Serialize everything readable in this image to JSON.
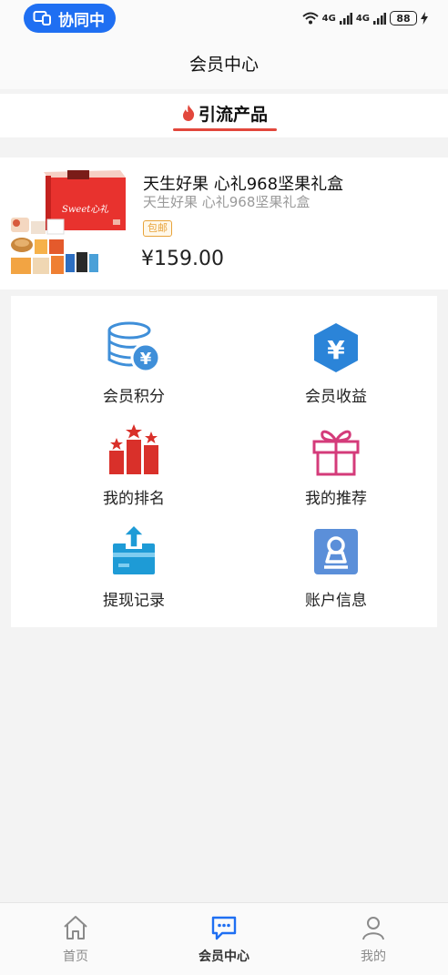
{
  "status_bar": {
    "collab_label": "协同中",
    "network_labels": [
      "4G",
      "4G"
    ],
    "battery": "88"
  },
  "header": {
    "title": "会员中心"
  },
  "section_tab": {
    "label": "引流产品"
  },
  "product": {
    "title": "天生好果 心礼968坚果礼盒",
    "subtitle": "天生好果 心礼968坚果礼盒",
    "badge": "包邮",
    "price": "¥159.00"
  },
  "menu": {
    "items": [
      {
        "label": "会员积分",
        "icon": "coin-stack-yen-icon"
      },
      {
        "label": "会员收益",
        "icon": "hexagon-yen-icon"
      },
      {
        "label": "我的排名",
        "icon": "ranking-bars-stars-icon"
      },
      {
        "label": "我的推荐",
        "icon": "gift-box-icon"
      },
      {
        "label": "提现记录",
        "icon": "withdraw-card-icon"
      },
      {
        "label": "账户信息",
        "icon": "account-stamp-icon"
      }
    ]
  },
  "bottom_nav": {
    "items": [
      {
        "label": "首页",
        "icon": "home-icon"
      },
      {
        "label": "会员中心",
        "icon": "chat-bubble-icon",
        "active": true
      },
      {
        "label": "我的",
        "icon": "person-icon"
      }
    ]
  },
  "colors": {
    "accent_blue": "#1f6ff2",
    "tab_red": "#e2473c",
    "badge_orange": "#e8a33a",
    "ranking_red": "#d9302a",
    "gift_pink": "#d43b7a"
  }
}
